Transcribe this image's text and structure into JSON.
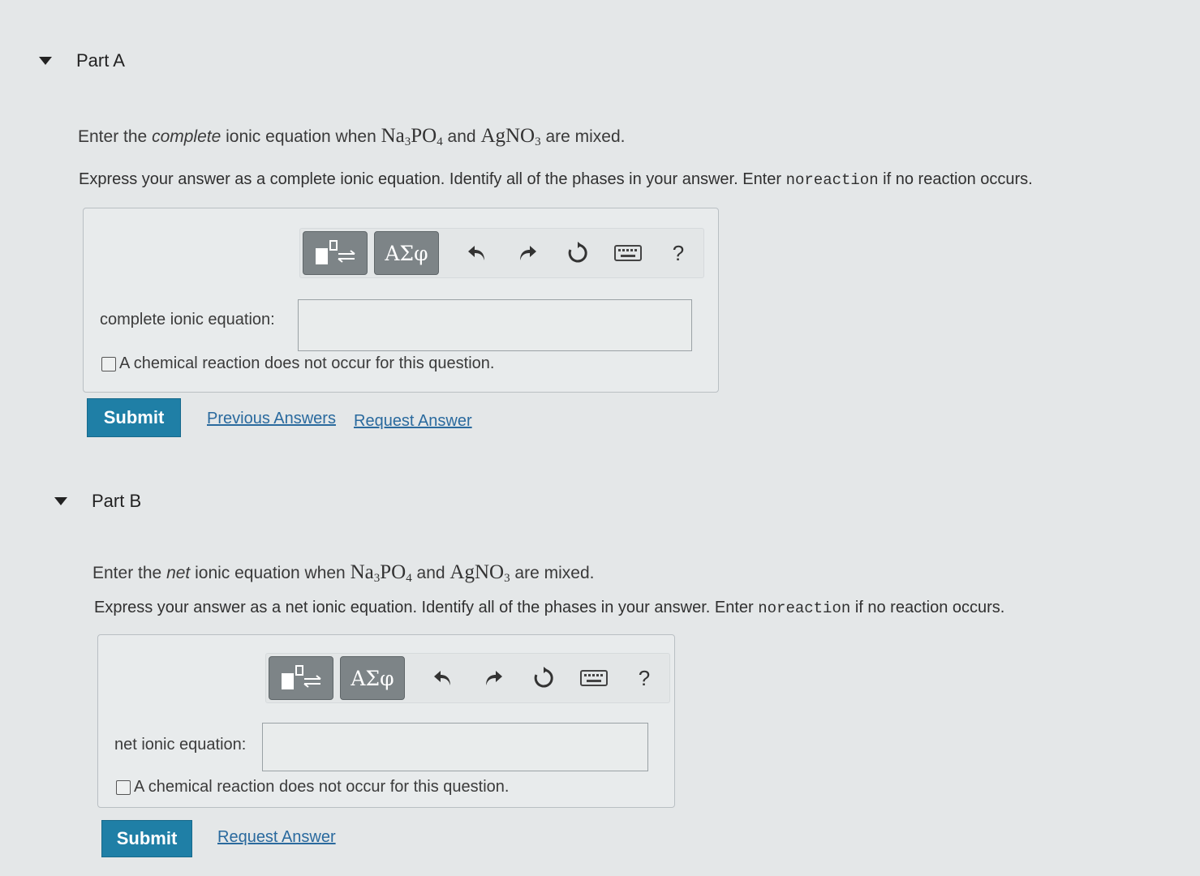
{
  "partA": {
    "title": "Part A",
    "prompt_pre": "Enter the ",
    "prompt_em": "complete",
    "prompt_mid": " ionic equation when ",
    "prompt_and": " and ",
    "prompt_post": " are mixed.",
    "instruction_pre": "Express your answer as a complete ionic equation. Identify all of the phases in your answer. Enter ",
    "instruction_code": "noreaction",
    "instruction_post": " if no reaction occurs.",
    "toolbar": {
      "greek_label": "ΑΣφ",
      "help_label": "?"
    },
    "equation_label": "complete ionic equation:",
    "equation_value": "",
    "no_reaction_label": "A chemical reaction does not occur for this question.",
    "no_reaction_checked": false,
    "submit_label": "Submit",
    "previous_answers_label": "Previous Answers",
    "request_answer_label": "Request Answer"
  },
  "partB": {
    "title": "Part B",
    "prompt_pre": "Enter the ",
    "prompt_em": "net",
    "prompt_mid": " ionic equation when ",
    "prompt_and": " and ",
    "prompt_post": " are mixed.",
    "instruction_pre": "Express your answer as a net ionic equation. Identify all of the phases in your answer. Enter ",
    "instruction_code": "noreaction",
    "instruction_post": " if no reaction occurs.",
    "toolbar": {
      "greek_label": "ΑΣφ",
      "help_label": "?"
    },
    "equation_label": "net ionic equation:",
    "equation_value": "",
    "no_reaction_label": "A chemical reaction does not occur for this question.",
    "no_reaction_checked": false,
    "submit_label": "Submit",
    "request_answer_label": "Request Answer"
  },
  "chem": {
    "reactant1": {
      "base": "Na",
      "sub1": "3",
      "mid": "PO",
      "sub2": "4"
    },
    "reactant2": {
      "base": "AgNO",
      "sub1": "3"
    }
  },
  "icons": [
    "caret-down-icon",
    "template-icon",
    "undo-icon",
    "redo-icon",
    "reset-icon",
    "keyboard-icon",
    "help-icon"
  ],
  "colors": {
    "submit": "#1f7fa6",
    "link": "#2a6a9e",
    "toolbar_button": "#7d8487"
  }
}
